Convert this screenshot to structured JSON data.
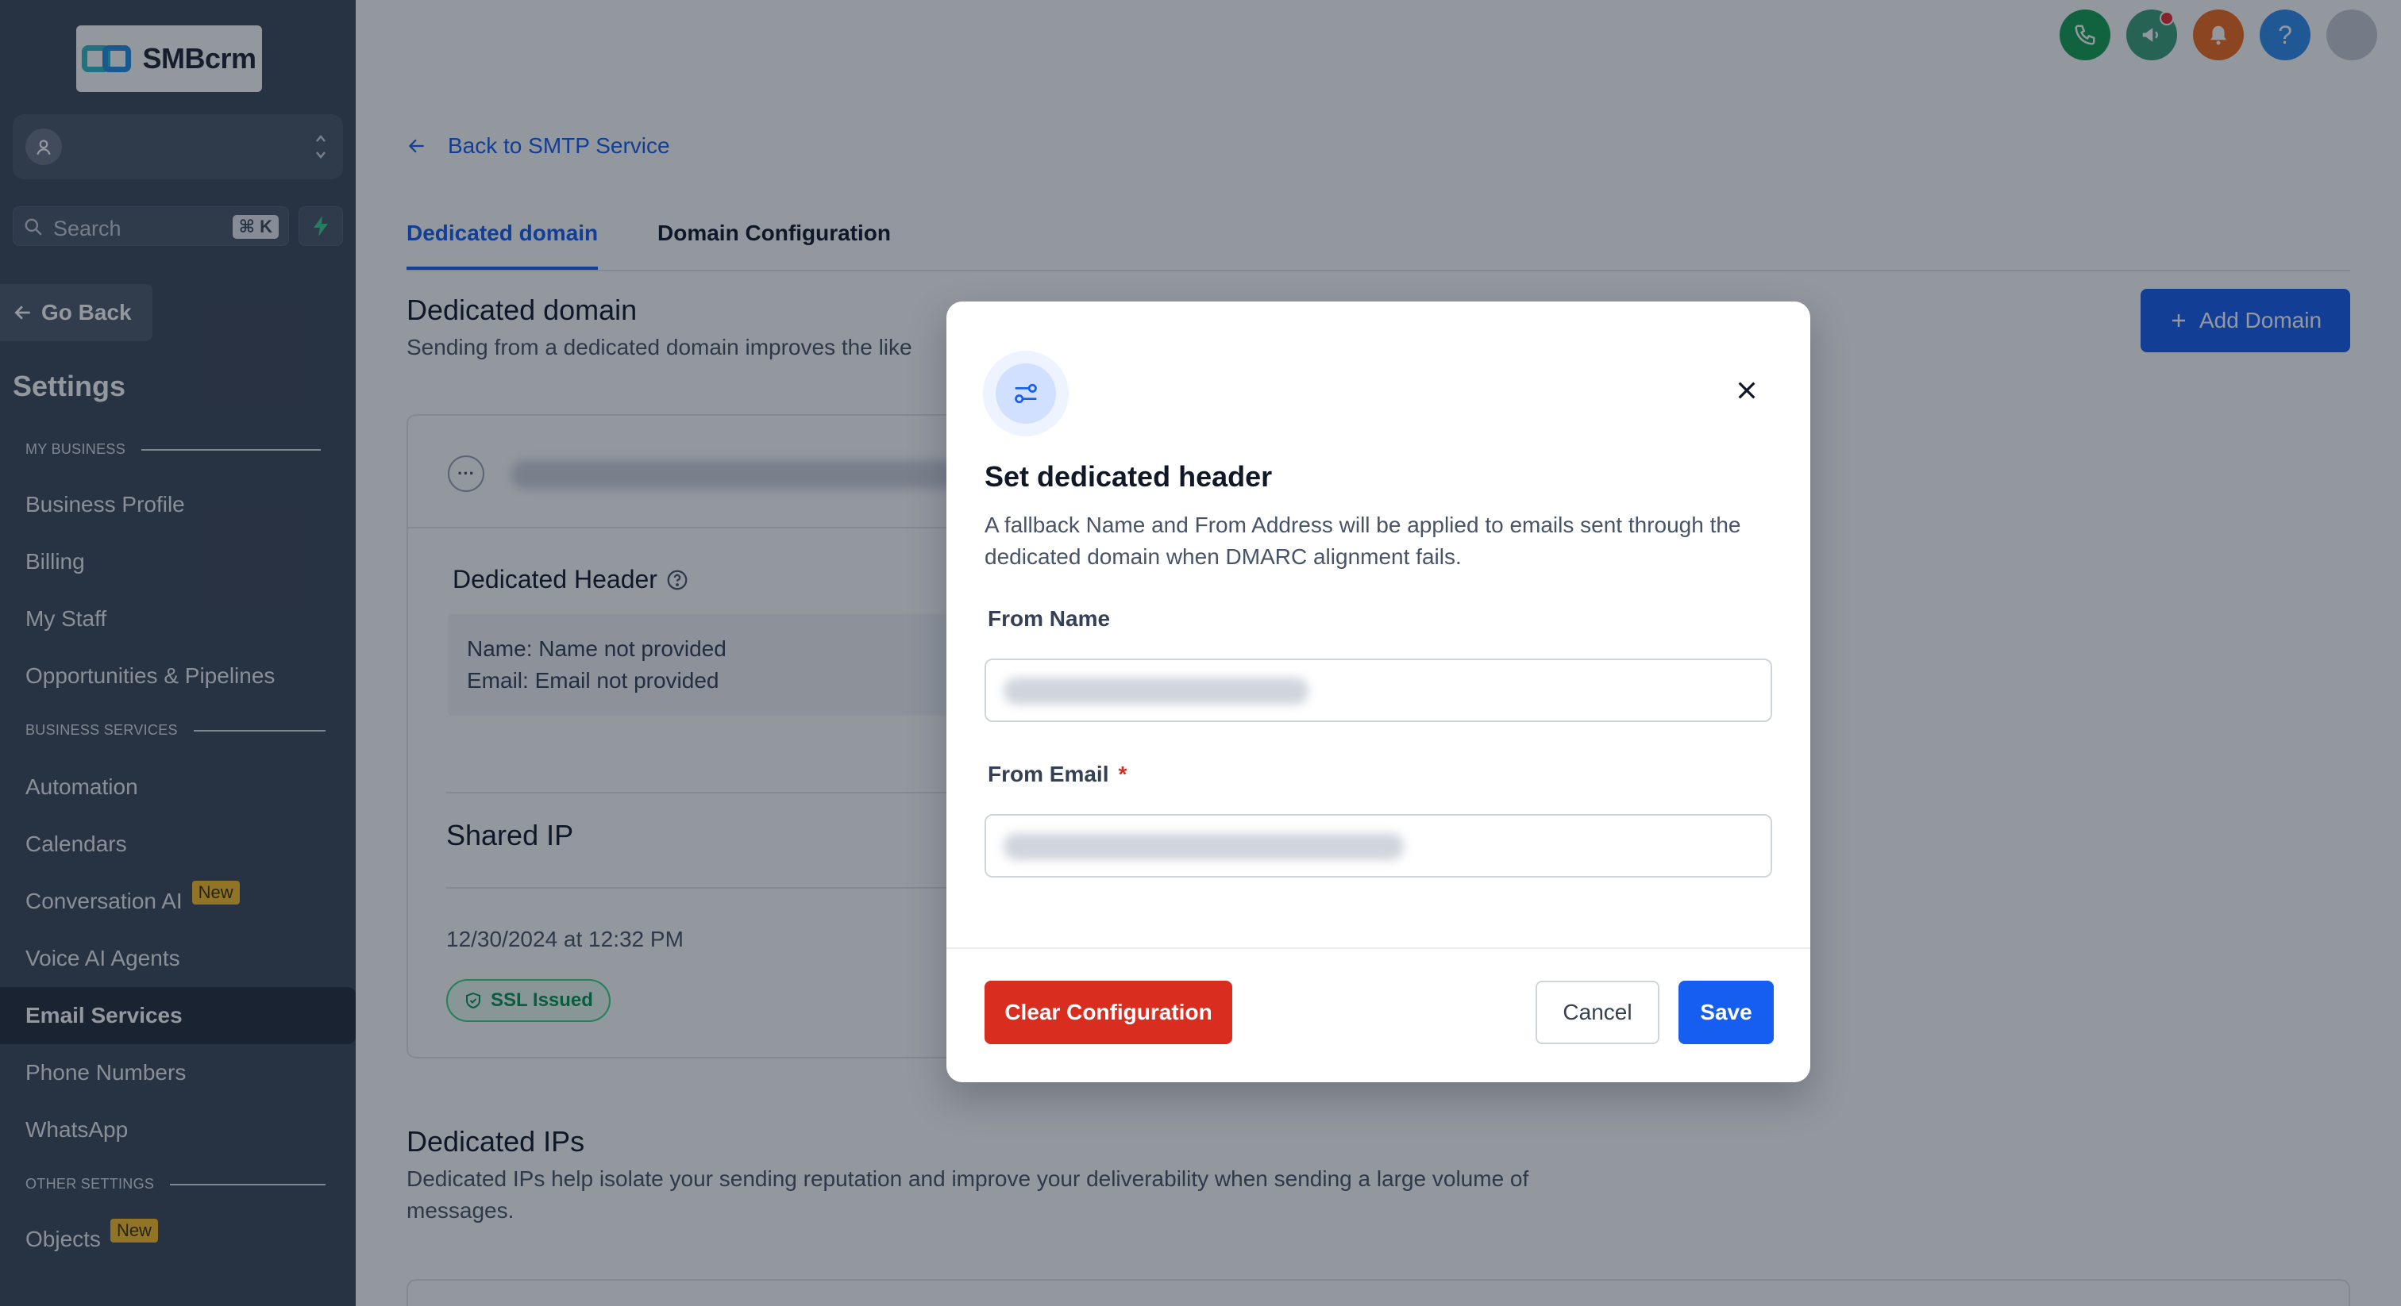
{
  "brand": {
    "name": "SMBcrm"
  },
  "search": {
    "placeholder": "Search",
    "shortcut": "⌘ K"
  },
  "sidebar": {
    "go_back": "Go Back",
    "title": "Settings",
    "sections": {
      "my_business": "MY BUSINESS",
      "business_services": "BUSINESS SERVICES",
      "other_settings": "OTHER SETTINGS"
    },
    "items": [
      {
        "label": "Business Profile"
      },
      {
        "label": "Billing"
      },
      {
        "label": "My Staff"
      },
      {
        "label": "Opportunities & Pipelines"
      },
      {
        "label": "Automation"
      },
      {
        "label": "Calendars"
      },
      {
        "label": "Conversation AI",
        "badge": "New"
      },
      {
        "label": "Voice AI Agents"
      },
      {
        "label": "Email Services"
      },
      {
        "label": "Phone Numbers"
      },
      {
        "label": "WhatsApp"
      },
      {
        "label": "Objects",
        "badge": "New"
      }
    ]
  },
  "topbar": {
    "icons": [
      "phone-icon",
      "megaphone-icon",
      "bell-icon",
      "help-icon",
      "user-avatar"
    ],
    "colors": {
      "phone": "#12a150",
      "megaphone": "#3aa07a",
      "bell": "#f26b1d",
      "help": "#2e8cf0"
    }
  },
  "main": {
    "back_link": "Back to SMTP Service",
    "tabs": [
      {
        "label": "Dedicated domain",
        "active": true
      },
      {
        "label": "Domain Configuration",
        "active": false
      }
    ],
    "dedicated_domain": {
      "title": "Dedicated domain",
      "description": "Sending from a dedicated domain improves the like",
      "add_button": "Add Domain"
    },
    "card": {
      "header_title": "Dedicated Header",
      "name_label": "Name:",
      "name_value": "Name not provided",
      "email_label": "Email:",
      "email_value": "Email not provided",
      "shared_ip": "Shared IP",
      "date": "12/30/2024 at 12:32 PM",
      "ssl_badge": "SSL Issued"
    },
    "dedicated_ips": {
      "title": "Dedicated IPs",
      "description_line1": "Dedicated IPs help isolate your sending reputation and improve your deliverability when sending a large volume of",
      "description_line2": "messages."
    }
  },
  "modal": {
    "title": "Set dedicated header",
    "description_line1": "A fallback Name and From Address will be applied to emails sent through the",
    "description_line2": "dedicated domain when DMARC alignment fails.",
    "from_name_label": "From Name",
    "from_email_label": "From Email",
    "required_marker": "*",
    "clear_button": "Clear Configuration",
    "cancel_button": "Cancel",
    "save_button": "Save"
  },
  "colors": {
    "sidebar_bg": "#3b4758",
    "primary": "#155eef",
    "danger": "#d92d20",
    "badge_new": "#fbbf24",
    "success": "#079455"
  }
}
